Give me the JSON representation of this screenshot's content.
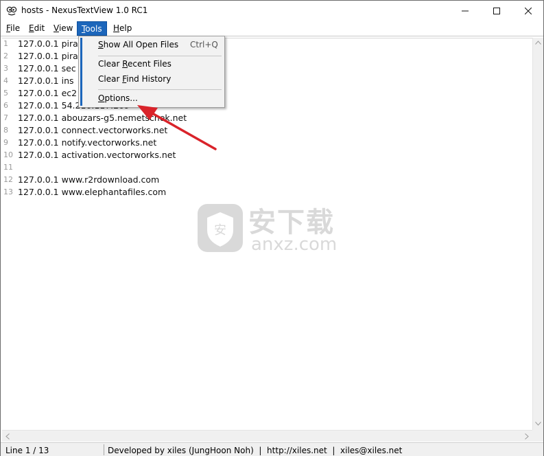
{
  "window": {
    "title": "hosts - NexusTextView 1.0 RC1"
  },
  "menubar": {
    "items": [
      {
        "label_pre": "",
        "label_ul": "F",
        "label_post": "ile"
      },
      {
        "label_pre": "",
        "label_ul": "E",
        "label_post": "dit"
      },
      {
        "label_pre": "",
        "label_ul": "V",
        "label_post": "iew"
      },
      {
        "label_pre": "",
        "label_ul": "T",
        "label_post": "ools"
      },
      {
        "label_pre": "",
        "label_ul": "H",
        "label_post": "elp"
      }
    ],
    "active": "Tools"
  },
  "dropdown": {
    "items": [
      {
        "pre": "",
        "ul": "S",
        "post": "how All Open Files",
        "shortcut": "Ctrl+Q"
      },
      {
        "pre": "Clear ",
        "ul": "R",
        "post": "ecent Files"
      },
      {
        "pre": "Clear ",
        "ul": "F",
        "post": "ind History"
      },
      {
        "pre": "",
        "ul": "O",
        "post": "ptions..."
      }
    ]
  },
  "editor": {
    "lines": [
      {
        "num": "1",
        "text": "127.0.0.1 pira"
      },
      {
        "num": "2",
        "text": "127.0.0.1 pira"
      },
      {
        "num": "3",
        "text": "127.0.0.1 sec"
      },
      {
        "num": "4",
        "text": "127.0.0.1 ins"
      },
      {
        "num": "5",
        "text": "127.0.0.1 ec2"
      },
      {
        "num": "6",
        "text": "127.0.0.1 54.216.117.209"
      },
      {
        "num": "7",
        "text": "127.0.0.1 abouzars-g5.nemetschek.net"
      },
      {
        "num": "8",
        "text": "127.0.0.1 connect.vectorworks.net"
      },
      {
        "num": "9",
        "text": "127.0.0.1 notify.vectorworks.net"
      },
      {
        "num": "10",
        "text": "127.0.0.1 activation.vectorworks.net"
      },
      {
        "num": "11",
        "text": ""
      },
      {
        "num": "12",
        "text": "127.0.0.1 www.r2rdownload.com"
      },
      {
        "num": "13",
        "text": "127.0.0.1 www.elephantafiles.com"
      }
    ]
  },
  "statusbar": {
    "position": "Line 1 / 13",
    "credit": "Developed by xiles (JungHoon Noh)  |  http://xiles.net  |  xiles@xiles.net"
  },
  "watermark": {
    "cn": "安下载",
    "en": "anxz.com"
  },
  "colors": {
    "accent": "#1c66bb",
    "annotation_arrow": "#d9232a",
    "line_numbers": "#9a9a9a"
  }
}
